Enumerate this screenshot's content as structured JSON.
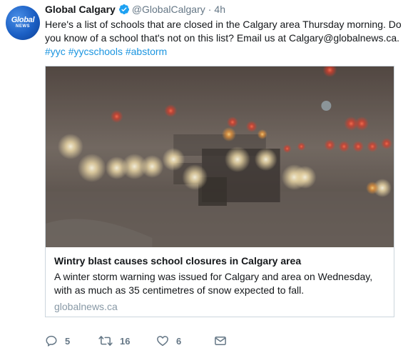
{
  "account": {
    "display_name": "Global Calgary",
    "handle": "@GlobalCalgary",
    "separator": "·",
    "time": "4h",
    "avatar_logo_main": "Global",
    "avatar_logo_sub": "NEWS"
  },
  "tweet": {
    "text": "Here's a list of schools that are closed in the Calgary area Thursday morning. Do you know of a school that's not on this list? Email us at Calgary@globalnews.ca.",
    "hashtags": [
      "#yyc",
      "#yycschools",
      "#abstorm"
    ]
  },
  "card": {
    "title": "Wintry blast causes school closures in Calgary area",
    "description": "A winter storm warning was issued for Calgary and area on Wednesday, with as much as 35 centimetres of snow expected to fall.",
    "domain": "globalnews.ca"
  },
  "actions": {
    "replies": "5",
    "retweets": "16",
    "likes": "6"
  },
  "icons": {
    "reply": "reply-icon",
    "retweet": "retweet-icon",
    "like": "heart-icon",
    "message": "envelope-icon",
    "verified": "verified-badge-icon"
  },
  "colors": {
    "link": "#1b95e0",
    "muted": "#657786",
    "verified": "#1da1f2"
  }
}
